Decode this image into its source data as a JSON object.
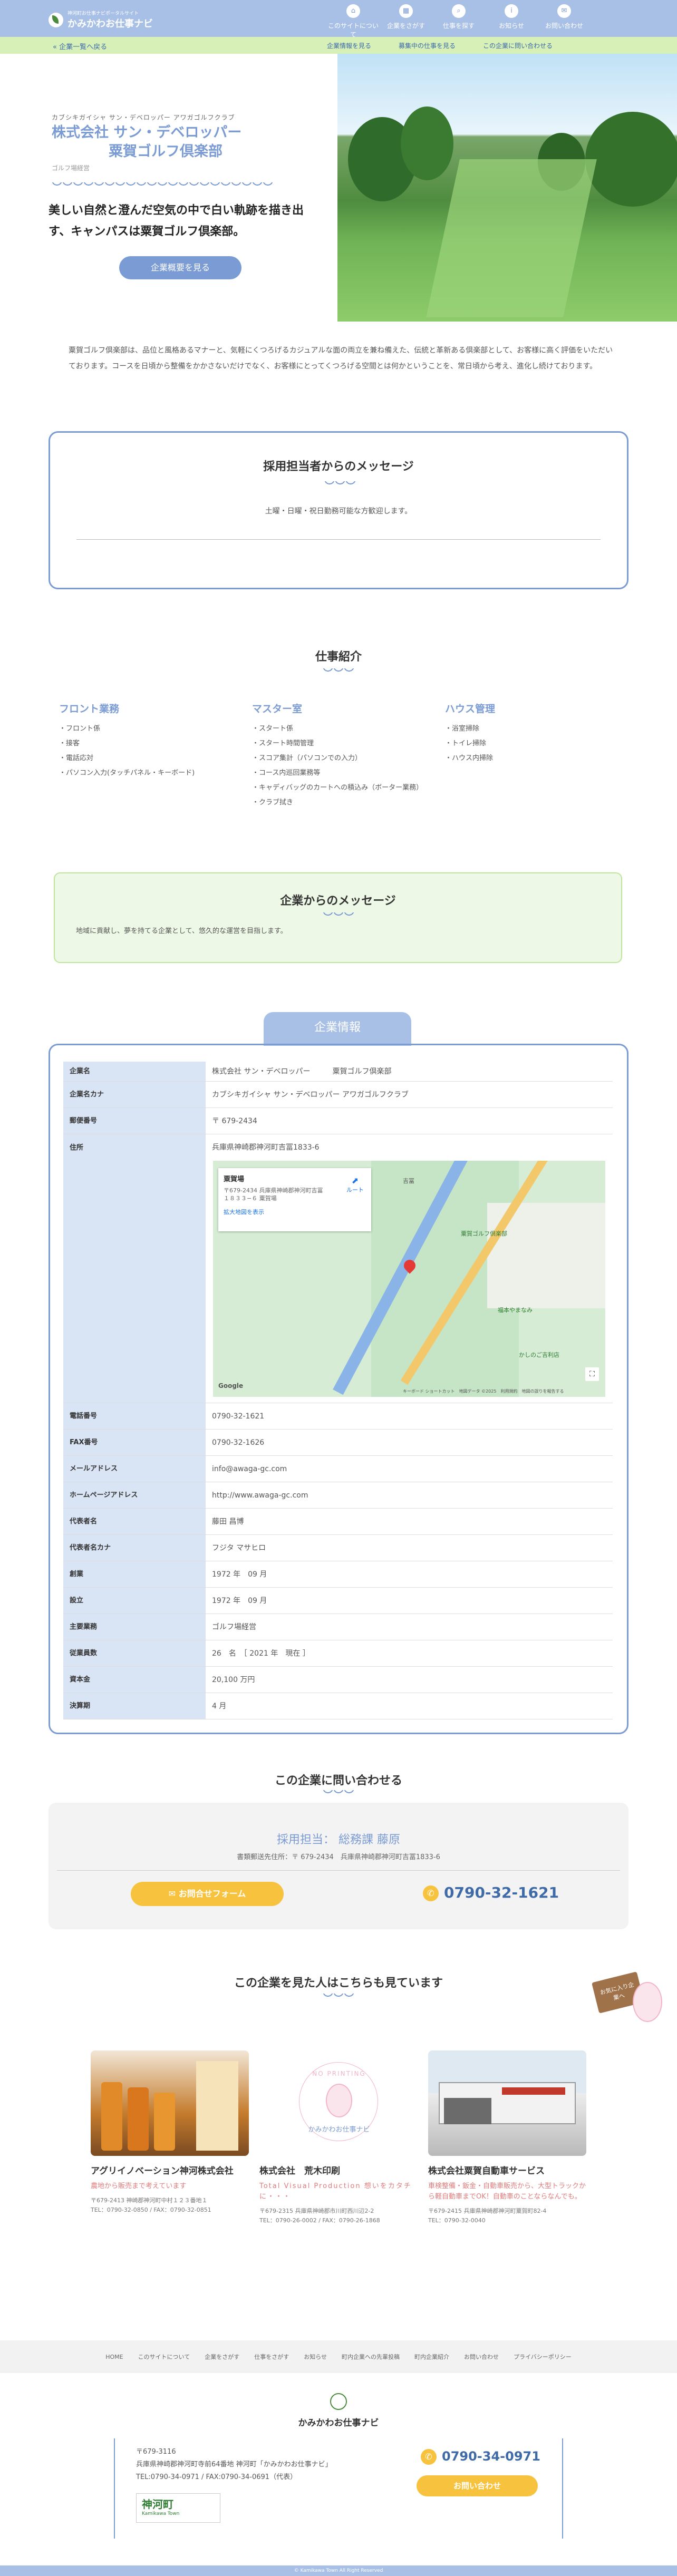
{
  "header": {
    "logo_sub": "神河町お仕事ナビポータルサイト",
    "logo_main": "かみかわお仕事ナビ",
    "nav": [
      {
        "icon": "home-icon",
        "glyph": "⌂",
        "label": "このサイトについて"
      },
      {
        "icon": "company-icon",
        "glyph": "▦",
        "label": "企業をさがす"
      },
      {
        "icon": "search-icon",
        "glyph": "⌕",
        "label": "仕事を探す"
      },
      {
        "icon": "info-icon",
        "glyph": "i",
        "label": "お知らせ"
      },
      {
        "icon": "mail-icon",
        "glyph": "✉",
        "label": "お問い合わせ"
      }
    ]
  },
  "subbar": {
    "back": "« 企業一覧へ戻る",
    "links": [
      "企業情報を見る",
      "募集中の仕事を見る",
      "この企業に問い合わせる"
    ]
  },
  "hero": {
    "kana": "カブシキガイシャ サン・デベロッパー アワガゴルフクラブ",
    "name_line1": "株式会社 サン・デベロッパー",
    "name_line2": "粟賀ゴルフ倶楽部",
    "industry": "ゴルフ場経営",
    "tagline": "美しい自然と澄んだ空気の中で白い軌跡を描き出す、キャンパスは粟賀ゴルフ倶楽部。",
    "button": "企業概要を見る"
  },
  "intro": "粟賀ゴルフ倶楽部は、品位と風格あるマナーと、気軽にくつろげるカジュアルな面の両立を兼ね備えた、伝統と革新ある倶楽部として、お客様に高く評価をいただいております。コースを日頃から整備をかかさないだけでなく、お客様にとってくつろげる空間とは何かということを、常日頃から考え、進化し続けております。",
  "recruiter": {
    "title": "採用担当者からのメッセージ",
    "text": "土曜・日曜・祝日勤務可能な方歓迎します。"
  },
  "work": {
    "title": "仕事紹介",
    "jobs": [
      {
        "title": "フロント業務",
        "items": [
          "・フロント係",
          "・接客",
          "・電話応対",
          "・パソコン入力(タッチパネル・キーボード)"
        ]
      },
      {
        "title": "マスター室",
        "items": [
          "・スタート係",
          "・スタート時間管理",
          "・スコア集計（パソコンでの入力）",
          "・コース内巡回業務等",
          "・キャディバッグのカートへの積込み（ボーター業務）",
          "・クラブ拭き"
        ]
      },
      {
        "title": "ハウス管理",
        "items": [
          "・浴室掃除",
          "・トイレ掃除",
          "・ハウス内掃除"
        ]
      }
    ]
  },
  "company_msg": {
    "title": "企業からのメッセージ",
    "text": "地域に貢献し、夢を持てる企業として、悠久的な運営を目指します。"
  },
  "company_info": {
    "tab": "企業情報",
    "rows_top": [
      {
        "k": "企業名",
        "v": "株式会社 サン・デベロッパー　　　粟賀ゴルフ倶楽部"
      },
      {
        "k": "企業名カナ",
        "v": "カブシキガイシャ サン・デベロッパー アワガゴルフクラブ"
      },
      {
        "k": "郵便番号",
        "v": "〒 679-2434"
      }
    ],
    "address_k": "住所",
    "address_v": "兵庫県神崎郡神河町吉冨1833-6",
    "map": {
      "place": "粟賀場",
      "place_addr": "〒679-2434 兵庫県神崎郡神河町吉冨１８３３−６ 粟賀場",
      "route": "ルート",
      "larger": "拡大地図を表示",
      "label_a": "吉冨",
      "label_b": "粟賀ゴルフ倶楽部",
      "label_c": "福本やまなみ",
      "label_d": "かしのご吉利店",
      "google": "Google",
      "credit": "キーボード ショートカット　地図データ ©2025　利用規約　地図の誤りを報告する"
    },
    "rows_bottom": [
      {
        "k": "電話番号",
        "v": "0790-32-1621"
      },
      {
        "k": "FAX番号",
        "v": "0790-32-1626"
      },
      {
        "k": "メールアドレス",
        "v": "info@awaga-gc.com"
      },
      {
        "k": "ホームページアドレス",
        "v": "http://www.awaga-gc.com"
      },
      {
        "k": "代表者名",
        "v": "藤田 昌博"
      },
      {
        "k": "代表者名カナ",
        "v": "フジタ マサヒロ"
      },
      {
        "k": "創業",
        "v": "1972 年　09 月"
      },
      {
        "k": "設立",
        "v": "1972 年　09 月"
      },
      {
        "k": "主要業務",
        "v": "ゴルフ場経営"
      },
      {
        "k": "従業員数",
        "v": "26　名　［ 2021 年　現在 ］"
      },
      {
        "k": "資本金",
        "v": "20,100 万円"
      },
      {
        "k": "決算期",
        "v": "4 月"
      }
    ]
  },
  "contact": {
    "title": "この企業に問い合わせる",
    "person": "採用担当：  総務課 藤原",
    "address": "書類郵送先住所：〒 679-2434　兵庫県神崎郡神河町吉冨1833-6",
    "form_button": "✉ お問合せフォーム",
    "phone": "0790-32-1621"
  },
  "seen": {
    "title": "この企業を見た人はこちらも見ています",
    "badge": "お気に入り企業へ",
    "cards": [
      {
        "name": "アグリイノベーション神河株式会社",
        "slogan": "農地から販売まで考えています",
        "addr": "〒679-2413 神崎郡神河町中村１２３番地１\nTEL：0790-32-0850 / FAX：0790-32-0851"
      },
      {
        "name": "株式会社　荒木印刷",
        "slogan": "Total Visual Production 想いをカタチに・・・",
        "noimage": "NO PRINTING",
        "noimage_logo": "かみかわお仕事ナビ",
        "addr": "〒679-2315 兵庫県神崎郡市川町西川辺2-2\nTEL：0790-26-0002 / FAX：0790-26-1868"
      },
      {
        "name": "株式会社粟賀自動車サービス",
        "slogan": "車検整備・鈑金・自動車販売から、大型トラックから軽自動車までOK！自動車のことならなんでも。",
        "addr": "〒679-2415 兵庫県神崎郡神河町粟賀町82-4\nTEL：0790-32-0040"
      }
    ]
  },
  "footer_nav": [
    "HOME",
    "このサイトについて",
    "企業をさがす",
    "仕事をさがす",
    "お知らせ",
    "町内企業への先輩投稿",
    "町内企業紹介",
    "お問い合わせ",
    "プライバシーポリシー"
  ],
  "footer": {
    "logo": "かみかわお仕事ナビ",
    "zip": "〒679-3116",
    "addr": "兵庫県神崎郡神河町寺前64番地 神河町「かみかわお仕事ナビ」",
    "tel": "TEL:0790-34-0971 / FAX:0790-34-0691（代表）",
    "town": "神河町",
    "town_en": "Kamikawa Town",
    "phone": "0790-34-0971",
    "button": "お問い合わせ",
    "copyright": "© Kamikawa Town All Right Reserved"
  },
  "colors": {
    "accent": "#7a9bd3",
    "green": "#d6f0b8",
    "yellow": "#f7c23e"
  }
}
